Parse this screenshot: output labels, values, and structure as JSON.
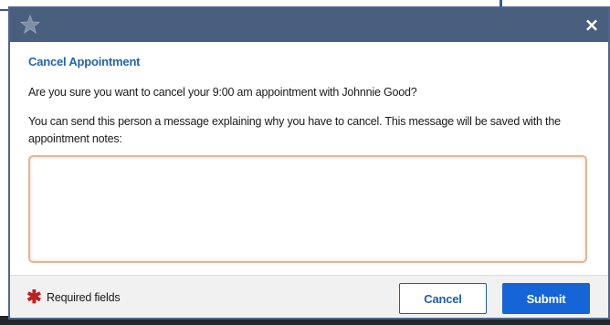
{
  "dialog": {
    "close_symbol": "×",
    "heading": "Cancel Appointment",
    "prompt": "Are you sure you want to cancel your 9:00 am appointment with Johnnie Good?",
    "explanation": "You can send this person a message explaining why you have to cancel. This message will be saved with the appointment notes:",
    "message_value": "",
    "message_placeholder": ""
  },
  "footer": {
    "required_star": "✱",
    "required_label": "Required fields",
    "cancel_label": "Cancel",
    "submit_label": "Submit"
  },
  "icons": {
    "logo": "star-logo-icon",
    "close": "close-icon",
    "required": "asterisk-icon"
  },
  "colors": {
    "title_bar": "#48607d",
    "heading": "#2265a8",
    "submit": "#1565d8",
    "required_star": "#c01f1f",
    "field_border": "#e8b48f"
  }
}
